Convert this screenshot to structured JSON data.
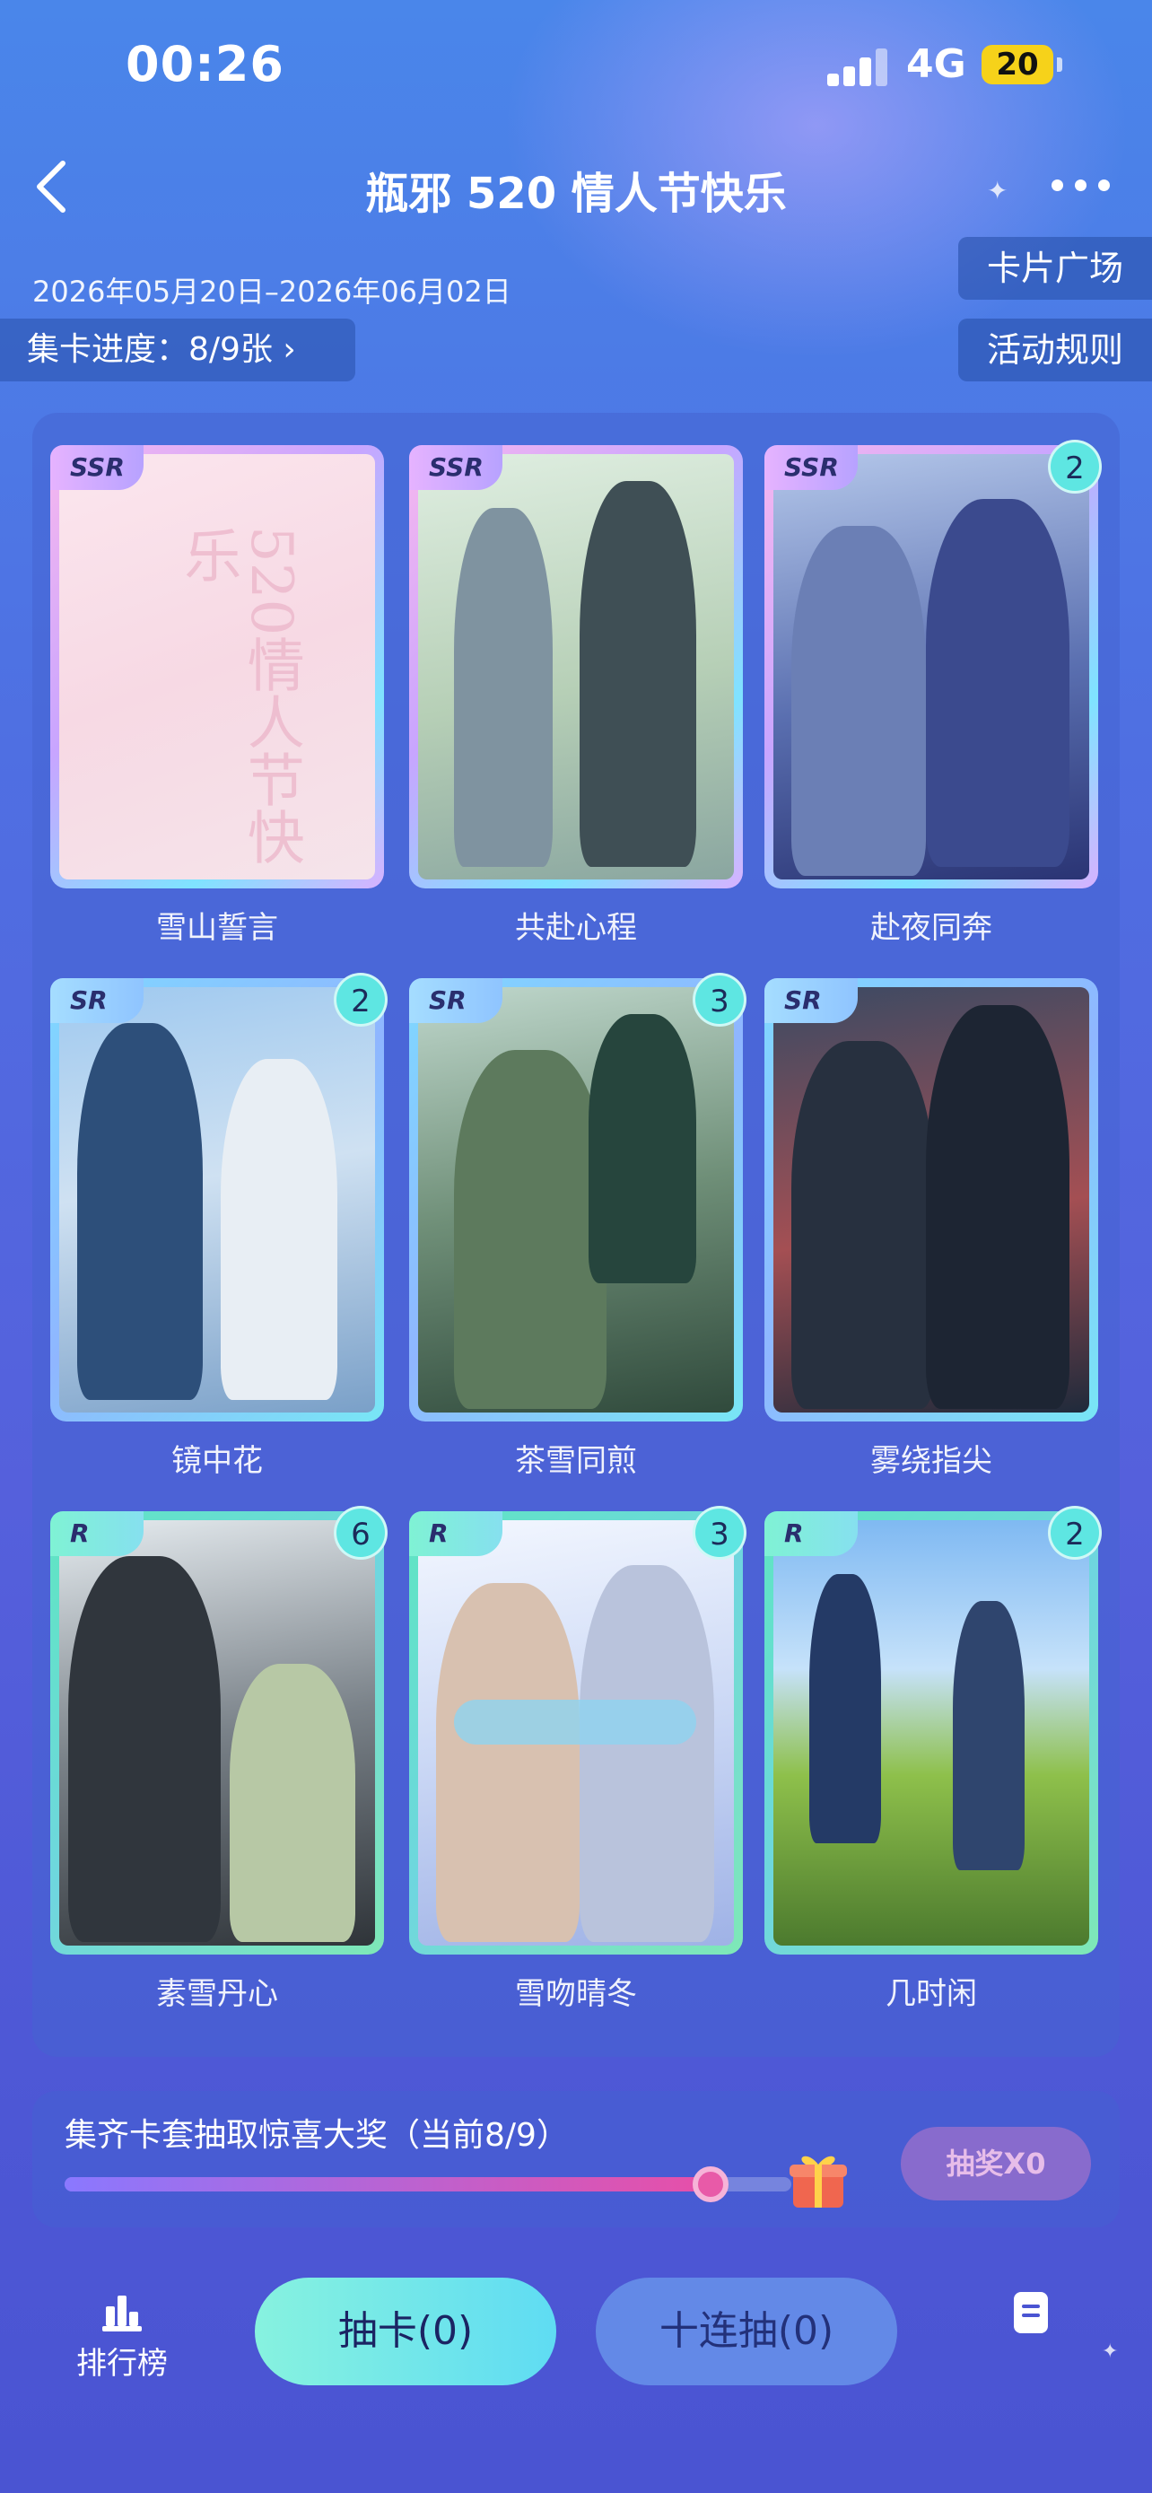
{
  "status_bar": {
    "time": "00:26",
    "network": "4G",
    "battery": "20"
  },
  "header": {
    "title": "瓶邪 520 情人节快乐"
  },
  "event": {
    "date_range": "2026年05月20日–2026年06月02日",
    "progress_label": "集卡进度：8/9张 ›",
    "card_square_label": "卡片广场",
    "rules_label": "活动规则"
  },
  "cards": [
    {
      "rarity": "SSR",
      "name": "雪山誓言",
      "count": "",
      "art_text": "520情人节快乐",
      "owned": false
    },
    {
      "rarity": "SSR",
      "name": "共赴心程",
      "count": "",
      "owned": true
    },
    {
      "rarity": "SSR",
      "name": "赴夜同奔",
      "count": "2",
      "owned": true
    },
    {
      "rarity": "SR",
      "name": "镜中花",
      "count": "2",
      "owned": true
    },
    {
      "rarity": "SR",
      "name": "茶雪同煎",
      "count": "3",
      "owned": true
    },
    {
      "rarity": "SR",
      "name": "雾绕指尖",
      "count": "",
      "owned": true
    },
    {
      "rarity": "R",
      "name": "素雪丹心",
      "count": "6",
      "owned": true
    },
    {
      "rarity": "R",
      "name": "雪吻晴冬",
      "count": "3",
      "owned": true
    },
    {
      "rarity": "R",
      "name": "几时闲",
      "count": "2",
      "owned": true
    }
  ],
  "reward": {
    "title": "集齐卡套抽取惊喜大奖（当前8/9）",
    "progress": 0.889,
    "lottery_label": "抽奖X0"
  },
  "bottom_bar": {
    "ranking_label": "排行榜",
    "draw_label": "抽卡(0)",
    "ten_draw_label": "十连抽(0)"
  },
  "colors": {
    "accent": "#5fdcf3",
    "badge": "#5ee6e2",
    "progress_fill": "#e74fa8"
  }
}
